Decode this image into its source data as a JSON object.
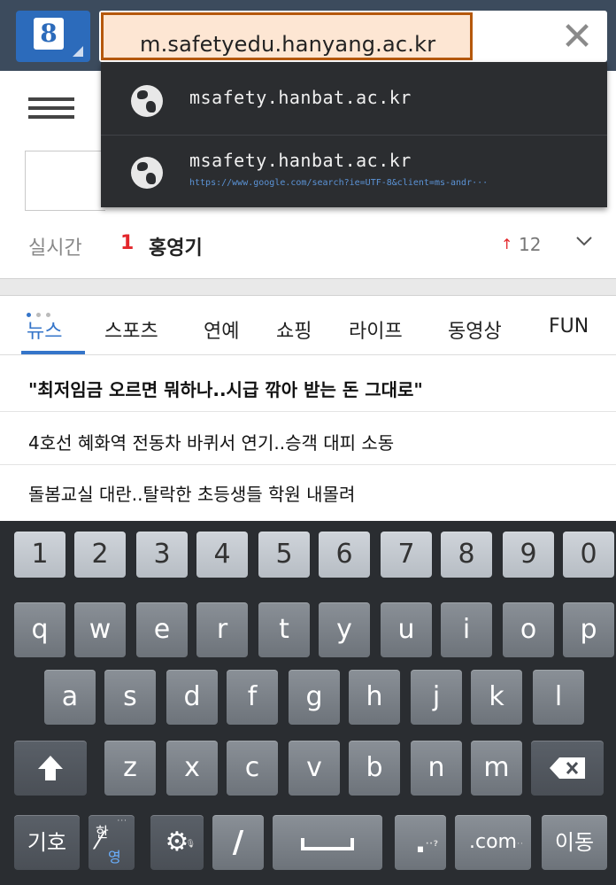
{
  "browser": {
    "url": "m.safetyedu.hanyang.ac.kr",
    "close_icon": "close-icon",
    "app_icon_letter": "8"
  },
  "suggestions": [
    {
      "title": "msafety.hanbat.ac.kr",
      "subtitle": ""
    },
    {
      "title": "msafety.hanbat.ac.kr",
      "subtitle": "https://www.google.com/search?ie=UTF-8&client=ms-andr···"
    }
  ],
  "realtime": {
    "label": "실시간",
    "rank": "1",
    "term": "홍영기",
    "up_arrow": "↑",
    "count": "12"
  },
  "tabs": [
    "뉴스",
    "스포츠",
    "연예",
    "쇼핑",
    "라이프",
    "동영상",
    "FUN"
  ],
  "news": [
    "\"최저임금 오르면 뭐하나..시급 깎아 받는 돈 그대로\"",
    "4호선 혜화역 전동차 바퀴서 연기..승객 대피 소동",
    "돌봄교실 대란..탈락한 초등생들 학원 내몰려"
  ],
  "keyboard": {
    "row_numbers": [
      "1",
      "2",
      "3",
      "4",
      "5",
      "6",
      "7",
      "8",
      "9",
      "0"
    ],
    "row1": [
      "q",
      "w",
      "e",
      "r",
      "t",
      "y",
      "u",
      "i",
      "o",
      "p"
    ],
    "row2": [
      "a",
      "s",
      "d",
      "f",
      "g",
      "h",
      "j",
      "k",
      "l"
    ],
    "row3": [
      "z",
      "x",
      "c",
      "v",
      "b",
      "n",
      "m"
    ],
    "bottom": {
      "symbols": "기호",
      "lang_top": "한",
      "lang_bottom": "영",
      "slash": "/",
      "dotkey": ".",
      "dotcom": ".com",
      "go": "이동"
    }
  },
  "colors": {
    "accent": "#3575c9",
    "highlight_border": "#b5580c",
    "rank_red": "#e3262b"
  }
}
